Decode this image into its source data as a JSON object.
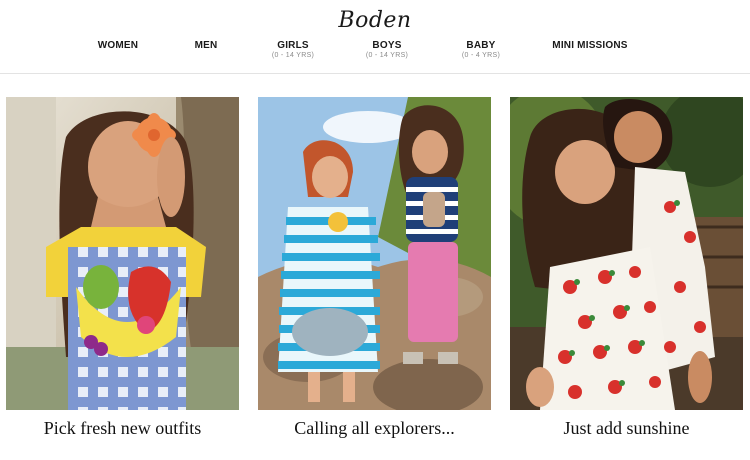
{
  "brand": {
    "logo_text": "Boden"
  },
  "nav": {
    "items": [
      {
        "label": "WOMEN",
        "sub": ""
      },
      {
        "label": "MEN",
        "sub": ""
      },
      {
        "label": "GIRLS",
        "sub": "(0 - 14 YRS)"
      },
      {
        "label": "BOYS",
        "sub": "(0 - 14 YRS)"
      },
      {
        "label": "BABY",
        "sub": "(0 - 4 YRS)"
      },
      {
        "label": "MINI MISSIONS",
        "sub": ""
      }
    ]
  },
  "tiles": [
    {
      "caption": "Pick fresh new outfits"
    },
    {
      "caption": "Calling all explorers..."
    },
    {
      "caption": "Just add sunshine"
    }
  ],
  "colors": {
    "text": "#1a1a1a",
    "sub_text": "#8a8a8a",
    "divider": "#e3e3e3"
  }
}
